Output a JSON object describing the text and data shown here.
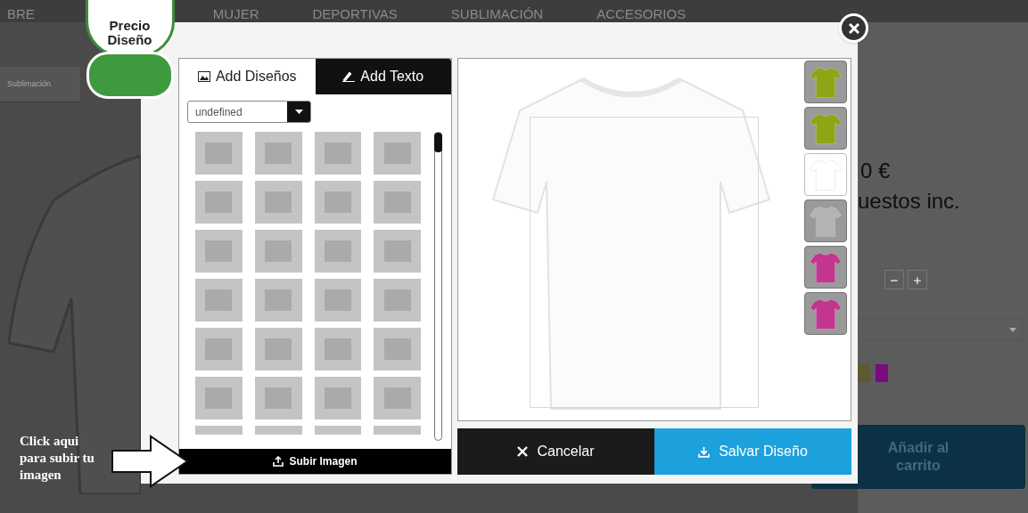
{
  "nav": [
    "BRE",
    "MUJER",
    "DEPORTIVAS",
    "SUBLIMACIÓN",
    "ACCESORIOS"
  ],
  "sidebar_item": "Sublimación",
  "product": {
    "price": "0 €",
    "tax_note": "uestos inc.",
    "quantity_minus": "−",
    "quantity_plus": "+",
    "swatches": [
      {
        "color": "#5c5a2e"
      },
      {
        "color": "#7a0a80"
      }
    ],
    "add_to_cart": "Añadir al carrito"
  },
  "price_badge": "Precio Diseño",
  "modal": {
    "tabs": [
      {
        "label": "Add Diseños",
        "selected": true
      },
      {
        "label": "Add Texto",
        "selected": false
      }
    ],
    "category_select": {
      "value": "undefined"
    },
    "upload_button": "Subir Imagen",
    "shirt_colors": [
      {
        "color": "#8ea515",
        "selected": false
      },
      {
        "color": "#8ea515",
        "selected": false
      },
      {
        "color": "#ffffff",
        "selected": true
      },
      {
        "color": "#b4b4b4",
        "selected": false
      },
      {
        "color": "#c2368f",
        "selected": false
      },
      {
        "color": "#c2368f",
        "selected": false
      }
    ],
    "cancel_button": "Cancelar",
    "save_button": "Salvar Diseño"
  },
  "callout": "Click aqui para subir tu imagen"
}
